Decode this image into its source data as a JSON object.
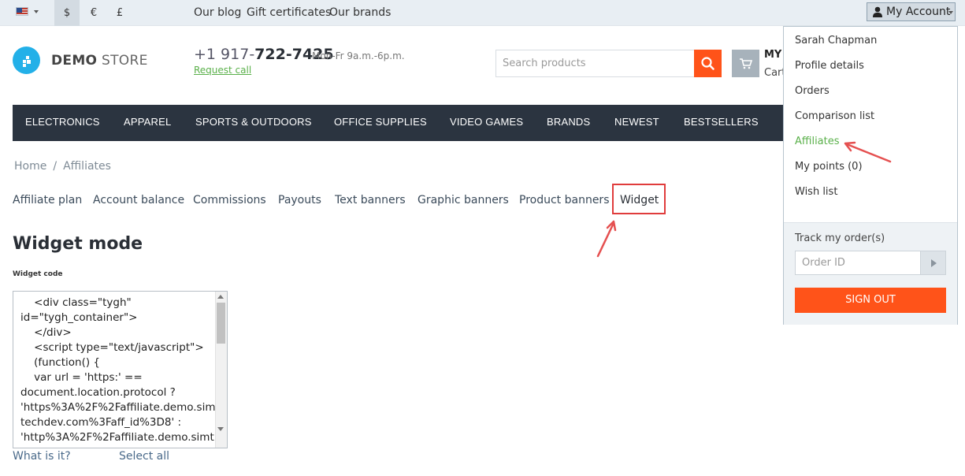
{
  "topbar": {
    "flag_icon": "us-flag-icon",
    "currencies": [
      "$",
      "€",
      "£"
    ],
    "links": [
      "Our blog",
      "Gift certificates",
      "Our brands"
    ],
    "my_account": "My Account"
  },
  "header": {
    "logo_bold": "DEMO",
    "logo_light": " STORE",
    "phone_prefix": "+1 917-",
    "phone_main": "722-7425",
    "hours": "Mon-Fr 9a.m.-6p.m.",
    "request_call": "Request call",
    "search_placeholder": "Search products",
    "cart_my": "MY",
    "cart_label": "Cart"
  },
  "nav": [
    "ELECTRONICS",
    "APPAREL",
    "SPORTS & OUTDOORS",
    "OFFICE SUPPLIES",
    "VIDEO GAMES",
    "BRANDS",
    "NEWEST",
    "BESTSELLERS"
  ],
  "breadcrumb": [
    "Home",
    "Affiliates"
  ],
  "tabs": [
    "Affiliate plan",
    "Account balance",
    "Commissions",
    "Payouts",
    "Text banners",
    "Graphic banners",
    "Product banners",
    "Widget"
  ],
  "main": {
    "title": "Widget mode",
    "code_label": "Widget code",
    "code": "    <div class=\"tygh\"\nid=\"tygh_container\">\n    </div>\n    <script type=\"text/javascript\">\n    (function() {\n    var url = 'https:' ==\ndocument.location.protocol ?\n'https%3A%2F%2Faffiliate.demo.sim\ntechdev.com%3Faff_id%3D8' :\n'http%3A%2F%2Faffiliate.demo.simt",
    "what_is_it": "What is it?",
    "select_all": "Select all"
  },
  "dropdown": {
    "items": [
      "Sarah Chapman",
      "Profile details",
      "Orders",
      "Comparison list",
      "Affiliates",
      "My points (0)",
      "Wish list"
    ],
    "active_item": "Affiliates",
    "track_label": "Track my order(s)",
    "order_placeholder": "Order ID",
    "sign_out": "SIGN OUT"
  },
  "colors": {
    "accent": "#ff5319",
    "nav_bg": "#2b3440",
    "active_link": "#5ab04a",
    "highlight": "#e03c3c"
  }
}
